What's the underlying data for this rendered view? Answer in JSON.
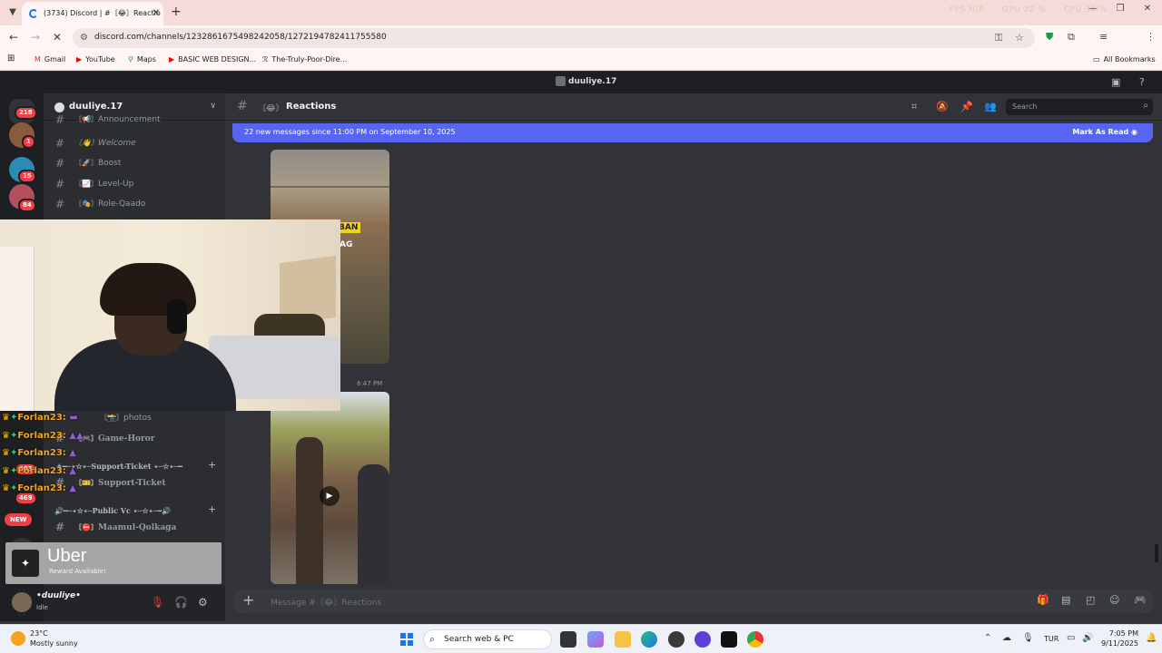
{
  "browser": {
    "tab_title": "(3734) Discord | #〘😂〙Reactio",
    "url": "discord.com/channels/1232861675498242058/1272194782411755580",
    "perf": [
      "FPS N/A",
      "GPU 22 %",
      "CPU 34 %"
    ],
    "bookmarks": [
      {
        "label": "Gmail",
        "icon": "gmail-icon"
      },
      {
        "label": "YouTube",
        "icon": "youtube-icon"
      },
      {
        "label": "Maps",
        "icon": "maps-icon"
      },
      {
        "label": "BASIC WEB DESIGN...",
        "icon": "youtube-icon"
      },
      {
        "label": "The-Truly-Poor-Dire...",
        "icon": "bookmark-icon"
      }
    ],
    "all_bookmarks": "All Bookmarks"
  },
  "discord": {
    "window_title": "duuliye.17",
    "server_name": "duuliye.17",
    "server_badges": [
      "218",
      "1",
      "15",
      "84",
      "503",
      "469"
    ],
    "channels": [
      {
        "emoji": "〘📢〙",
        "name": "Announcement"
      },
      {
        "emoji": "〘👋〙",
        "name": "Welcome"
      },
      {
        "emoji": "〘🚀〙",
        "name": "Boost"
      },
      {
        "emoji": "〘📈〙",
        "name": "Level-Up"
      },
      {
        "emoji": "〘🎭〙",
        "name": "Role-Qaado"
      },
      {
        "emoji": "〘📸〙",
        "name": "photos"
      },
      {
        "emoji": "〘🎮〙",
        "name": "Game-Horor"
      },
      {
        "emoji": "〘🎫〙",
        "name": "Support-Ticket"
      },
      {
        "emoji": "〘⛔〙",
        "name": "Maamul-Qolkaga"
      }
    ],
    "categories": {
      "support": "✦━─⋆☆⋆─Support-Ticket ⋆─☆⋆─━",
      "public_vc": "🔊━─⋆☆⋆─Public Vc ⋆─☆⋆─━🔊"
    },
    "new_pill": "NEW",
    "channel_header": {
      "emoji": "〘😂〙",
      "name": "Reactions"
    },
    "search_placeholder": "Search",
    "new_messages_bar": {
      "text": "22 new messages since 11:00 PM on September 10, 2025",
      "action": "Mark As Read"
    },
    "image_labels": [
      "BAN",
      "AG"
    ],
    "message_time": "6:47 PM",
    "composer_placeholder": "Message #〘😂〙Reactions",
    "user": {
      "name": "•duuliye•",
      "status": "Idle"
    }
  },
  "overlay_chat": [
    {
      "user": "Forlan23:",
      "msg": ""
    },
    {
      "user": "Forlan23:",
      "msg": ""
    },
    {
      "user": "Forlan23:",
      "msg": ""
    },
    {
      "user": "Forlan23:",
      "msg": ""
    },
    {
      "user": "Forlan23:",
      "msg": ""
    }
  ],
  "uber_notice": {
    "title": "Uber",
    "subtitle": "Reward Available!"
  },
  "taskbar": {
    "weather_temp": "23°C",
    "weather_cond": "Mostly sunny",
    "search_placeholder": "Search web & PC",
    "lang": "TUR",
    "time": "7:05 PM",
    "date": "9/11/2025"
  },
  "colors": {
    "discord_bg": "#313338",
    "blurple": "#5865f2",
    "badge_red": "#f23f43",
    "chrome_tint": "#f5dcd8"
  }
}
